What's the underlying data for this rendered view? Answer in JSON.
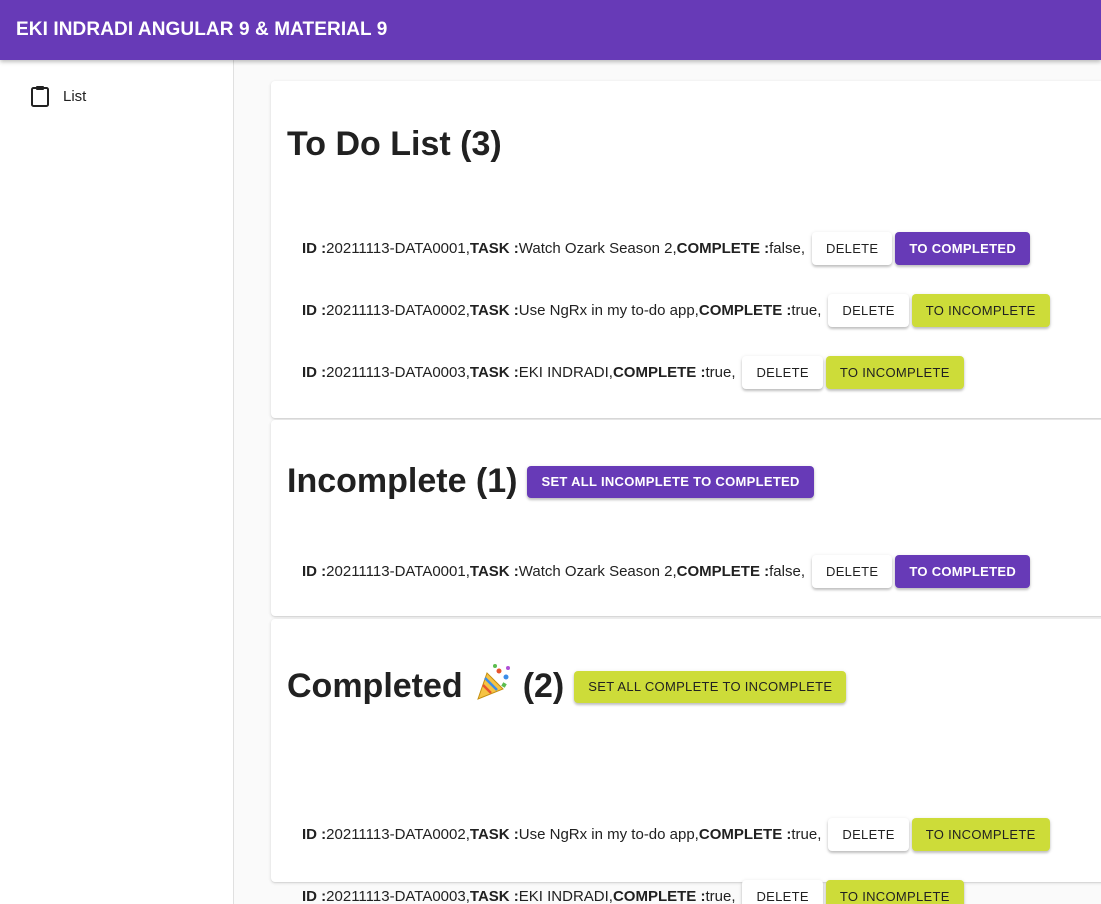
{
  "app": {
    "title": "EKI INDRADI ANGULAR 9 & MATERIAL 9"
  },
  "sidebar": {
    "items": [
      {
        "label": "List",
        "icon": "clipboard-icon"
      }
    ]
  },
  "colors": {
    "primary": "#673ab7",
    "accent": "#cddc39"
  },
  "labels": {
    "id": "ID :",
    "task": "TASK :",
    "complete": "COMPLETE :"
  },
  "buttons": {
    "delete": "DELETE",
    "to_completed": "TO COMPLETED",
    "to_incomplete": "TO INCOMPLETE"
  },
  "todo": {
    "title": "To Do List (3)",
    "items": [
      {
        "id": "20211113-DATA0001,",
        "task": "Watch Ozark Season 2,",
        "complete": "false,"
      },
      {
        "id": "20211113-DATA0002,",
        "task": "Use NgRx in my to-do app,",
        "complete": "true,"
      },
      {
        "id": "20211113-DATA0003,",
        "task": "EKI INDRADI,",
        "complete": "true,"
      }
    ]
  },
  "incomplete": {
    "title": "Incomplete (1)",
    "action": "SET ALL INCOMPLETE TO COMPLETED",
    "items": [
      {
        "id": "20211113-DATA0001,",
        "task": "Watch Ozark Season 2,",
        "complete": "false,"
      }
    ]
  },
  "completed": {
    "title_prefix": "Completed",
    "title_suffix": "(2)",
    "emoji": "🎉",
    "action": "SET ALL COMPLETE TO INCOMPLETE",
    "items": [
      {
        "id": "20211113-DATA0002,",
        "task": "Use NgRx in my to-do app,",
        "complete": "true,"
      },
      {
        "id": "20211113-DATA0003,",
        "task": "EKI INDRADI,",
        "complete": "true,"
      }
    ]
  }
}
